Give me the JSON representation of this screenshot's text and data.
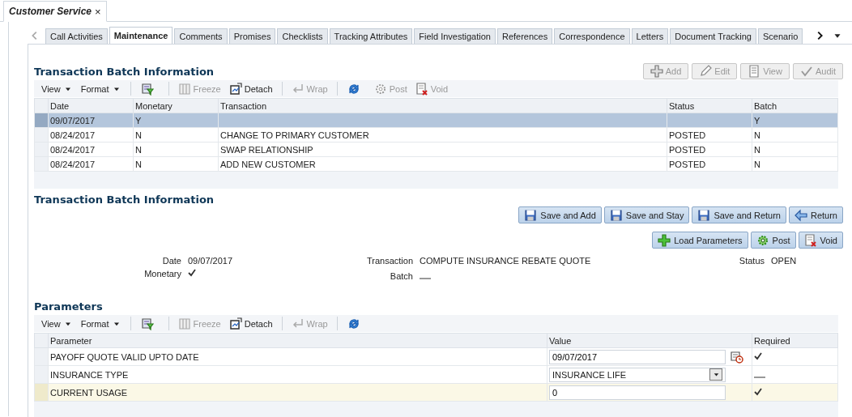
{
  "window_tab": {
    "title": "Customer Service",
    "close": "×"
  },
  "tabs": [
    {
      "label": "Call Activities",
      "selected": false
    },
    {
      "label": "Maintenance",
      "selected": true
    },
    {
      "label": "Comments",
      "selected": false
    },
    {
      "label": "Promises",
      "selected": false
    },
    {
      "label": "Checklists",
      "selected": false
    },
    {
      "label": "Tracking Attributes",
      "selected": false
    },
    {
      "label": "Field Investigation",
      "selected": false
    },
    {
      "label": "References",
      "selected": false
    },
    {
      "label": "Correspondence",
      "selected": false
    },
    {
      "label": "Letters",
      "selected": false
    },
    {
      "label": "Document Tracking",
      "selected": false
    },
    {
      "label": "Scenario",
      "selected": false
    }
  ],
  "batch_list": {
    "title": "Transaction Batch Information",
    "actions": [
      {
        "label": "Add",
        "kind": "add",
        "disabled": true
      },
      {
        "label": "Edit",
        "kind": "edit",
        "disabled": true
      },
      {
        "label": "View",
        "kind": "view",
        "disabled": true
      },
      {
        "label": "Audit",
        "kind": "audit",
        "disabled": true
      }
    ],
    "toolbar": [
      {
        "kind": "menu",
        "label": "View"
      },
      {
        "kind": "menu",
        "label": "Format"
      },
      {
        "kind": "sep"
      },
      {
        "kind": "filter"
      },
      {
        "kind": "sep"
      },
      {
        "kind": "freeze",
        "label": "Freeze",
        "disabled": true
      },
      {
        "kind": "detach",
        "label": "Detach",
        "disabled": false
      },
      {
        "kind": "sep"
      },
      {
        "kind": "wrap",
        "label": "Wrap",
        "disabled": true
      },
      {
        "kind": "sep"
      },
      {
        "kind": "refresh"
      },
      {
        "kind": "post",
        "label": "Post",
        "disabled": true
      },
      {
        "kind": "void",
        "label": "Void",
        "disabled": true
      }
    ],
    "columns": [
      "Date",
      "Monetary",
      "Transaction",
      "Status",
      "Batch"
    ],
    "rows": [
      {
        "cells": [
          "09/07/2017",
          "Y",
          "",
          "",
          "Y"
        ],
        "selected": true
      },
      {
        "cells": [
          "08/24/2017",
          "N",
          "CHANGE TO PRIMARY CUSTOMER",
          "POSTED",
          "N"
        ],
        "selected": false
      },
      {
        "cells": [
          "08/24/2017",
          "N",
          "SWAP RELATIONSHIP",
          "POSTED",
          "N"
        ],
        "selected": false
      },
      {
        "cells": [
          "08/24/2017",
          "N",
          "ADD NEW CUSTOMER",
          "POSTED",
          "N"
        ],
        "selected": false
      }
    ]
  },
  "batch_detail": {
    "title": "Transaction Batch Information",
    "actions": [
      {
        "label": "Save and Add",
        "kind": "save"
      },
      {
        "label": "Save and Stay",
        "kind": "save"
      },
      {
        "label": "Save and Return",
        "kind": "save"
      },
      {
        "label": "Return",
        "kind": "return"
      }
    ],
    "actions_2": [
      {
        "label": "Load Parameters",
        "kind": "load"
      },
      {
        "label": "Post",
        "kind": "post"
      },
      {
        "label": "Void",
        "kind": "void"
      }
    ],
    "date": {
      "label": "Date",
      "value": "09/07/2017"
    },
    "transaction": {
      "label": "Transaction",
      "value": "COMPUTE INSURANCE REBATE QUOTE"
    },
    "status": {
      "label": "Status",
      "value": "OPEN"
    },
    "monetary": {
      "label": "Monetary",
      "checked": true
    },
    "batch": {
      "label": "Batch",
      "checked": false
    }
  },
  "parameters": {
    "title": "Parameters",
    "toolbar": [
      {
        "kind": "menu",
        "label": "View"
      },
      {
        "kind": "menu",
        "label": "Format"
      },
      {
        "kind": "sep"
      },
      {
        "kind": "filter"
      },
      {
        "kind": "sep"
      },
      {
        "kind": "freeze",
        "label": "Freeze",
        "disabled": true
      },
      {
        "kind": "detach",
        "label": "Detach",
        "disabled": false
      },
      {
        "kind": "sep"
      },
      {
        "kind": "wrap",
        "label": "Wrap",
        "disabled": true
      },
      {
        "kind": "sep"
      },
      {
        "kind": "refresh"
      }
    ],
    "columns": [
      "Parameter",
      "Value",
      "Required"
    ],
    "rows": [
      {
        "parameter": "PAYOFF QUOTE VALID UPTO DATE",
        "kind": "date",
        "value": "09/07/2017",
        "required": true,
        "selected": false
      },
      {
        "parameter": "INSURANCE TYPE",
        "kind": "select",
        "value": "INSURANCE LIFE",
        "required": false,
        "selected": false
      },
      {
        "parameter": "CURRENT USAGE",
        "kind": "text",
        "value": "0",
        "required": true,
        "selected": true
      }
    ]
  }
}
